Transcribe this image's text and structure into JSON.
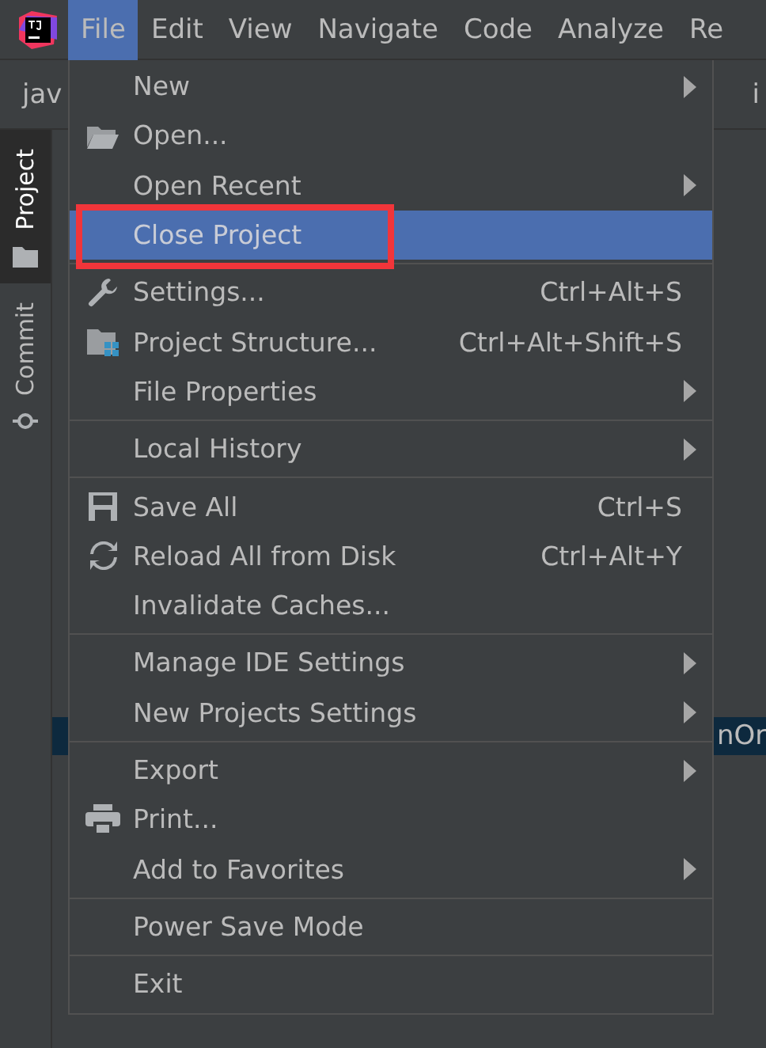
{
  "menubar": {
    "items": [
      {
        "label": "File",
        "selected": true
      },
      {
        "label": "Edit",
        "selected": false
      },
      {
        "label": "View",
        "selected": false
      },
      {
        "label": "Navigate",
        "selected": false
      },
      {
        "label": "Code",
        "selected": false
      },
      {
        "label": "Analyze",
        "selected": false
      },
      {
        "label": "Re",
        "selected": false
      }
    ]
  },
  "breadcrumb": [
    "jav",
    "i"
  ],
  "tool_window_tabs": [
    {
      "label": "Project",
      "selected": true
    },
    {
      "label": "Commit",
      "selected": false
    }
  ],
  "editor": {
    "highlighted_line": "nOr"
  },
  "file_menu": {
    "sections": [
      [
        {
          "label": "New",
          "submenu": true,
          "selected": false
        },
        {
          "label": "Open...",
          "submenu": false,
          "selected": false
        },
        {
          "label": "Open Recent",
          "submenu": true,
          "selected": false
        },
        {
          "label": "Close Project",
          "submenu": false,
          "selected": true,
          "outlined": true
        }
      ],
      [
        {
          "label": "Settings...",
          "shortcut": "Ctrl+Alt+S",
          "submenu": false,
          "selected": false
        },
        {
          "label": "Project Structure...",
          "shortcut": "Ctrl+Alt+Shift+S",
          "submenu": false,
          "selected": false
        },
        {
          "label": "File Properties",
          "submenu": true,
          "selected": false
        }
      ],
      [
        {
          "label": "Local History",
          "submenu": true,
          "selected": false
        }
      ],
      [
        {
          "label": "Save All",
          "shortcut": "Ctrl+S",
          "submenu": false,
          "selected": false
        },
        {
          "label": "Reload All from Disk",
          "shortcut": "Ctrl+Alt+Y",
          "submenu": false,
          "selected": false
        },
        {
          "label": "Invalidate Caches...",
          "submenu": false,
          "selected": false
        }
      ],
      [
        {
          "label": "Manage IDE Settings",
          "submenu": true,
          "selected": false
        },
        {
          "label": "New Projects Settings",
          "submenu": true,
          "selected": false
        }
      ],
      [
        {
          "label": "Export",
          "submenu": true,
          "selected": false
        },
        {
          "label": "Print...",
          "submenu": false,
          "selected": false
        },
        {
          "label": "Add to Favorites",
          "submenu": true,
          "selected": false
        }
      ],
      [
        {
          "label": "Power Save Mode",
          "submenu": false,
          "selected": false
        }
      ],
      [
        {
          "label": "Exit",
          "submenu": false,
          "selected": false
        }
      ]
    ]
  }
}
